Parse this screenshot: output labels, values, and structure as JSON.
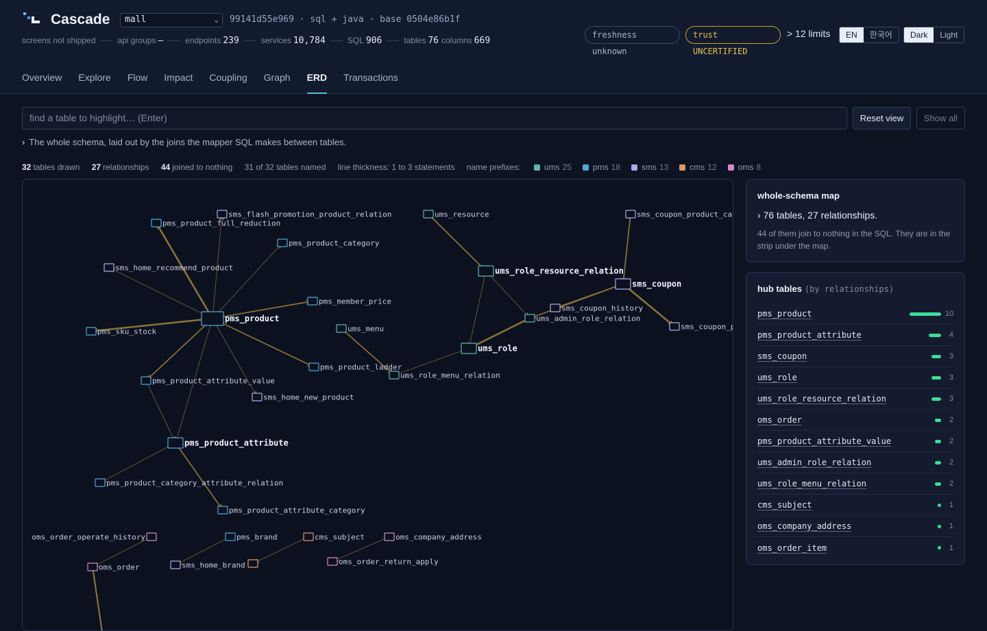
{
  "app": {
    "name": "Cascade",
    "repo": "mall",
    "meta": "99141d55e969 · sql + java · base 0504e86b1f"
  },
  "stats": [
    {
      "label": "screens not shipped",
      "value": ""
    },
    {
      "label": "api groups",
      "value": "—"
    },
    {
      "label": "endpoints",
      "value": "239"
    },
    {
      "label": "services",
      "value": "10,784"
    },
    {
      "label": "SQL",
      "value": "906"
    },
    {
      "label": "tables",
      "value": "76"
    },
    {
      "label": "columns",
      "value": "669"
    }
  ],
  "badges": {
    "freshness": "freshness unknown",
    "trust": "trust UNCERTIFIED",
    "limits": "> 12 limits"
  },
  "language": {
    "options": [
      "EN",
      "한국어"
    ],
    "active": "EN"
  },
  "theme": {
    "options": [
      "Dark",
      "Light"
    ],
    "active": "Dark"
  },
  "tabs": [
    "Overview",
    "Explore",
    "Flow",
    "Impact",
    "Coupling",
    "Graph",
    "ERD",
    "Transactions"
  ],
  "active_tab": "ERD",
  "search": {
    "placeholder": "find a table to highlight… (Enter)"
  },
  "buttons": {
    "reset": "Reset view",
    "show_all": "Show all"
  },
  "lede": "The whole schema, laid out by the joins the mapper SQL makes between tables.",
  "summary": {
    "tables_drawn": "32",
    "tables_drawn_label": "tables drawn",
    "relationships": "27",
    "relationships_label": "relationships",
    "isolated": "44",
    "isolated_label": "joined to nothing",
    "named": "31 of 32 tables named",
    "thickness": "line thickness: 1 to 3 statements",
    "prefixes_label": "name prefixes:"
  },
  "prefixes": [
    {
      "name": "ums",
      "count": "25",
      "color": "#5fb8a8"
    },
    {
      "name": "pms",
      "count": "18",
      "color": "#4fa9d4"
    },
    {
      "name": "sms",
      "count": "13",
      "color": "#a8aee8"
    },
    {
      "name": "cms",
      "count": "12",
      "color": "#d99a6c"
    },
    {
      "name": "oms",
      "count": "8",
      "color": "#d18ac9"
    }
  ],
  "erd": {
    "tables": [
      {
        "id": "sms_flash_promotion_product_relation",
        "label": "sms_flash_promotion_product_relation",
        "prefix": "sms"
      },
      {
        "id": "pms_product_full_reduction",
        "label": "pms_product_full_reduction",
        "prefix": "pms"
      },
      {
        "id": "pms_product_category",
        "label": "pms_product_category",
        "prefix": "pms"
      },
      {
        "id": "sms_home_recommend_product",
        "label": "sms_home_recommend_product",
        "prefix": "sms"
      },
      {
        "id": "pms_member_price",
        "label": "pms_member_price",
        "prefix": "pms"
      },
      {
        "id": "pms_product",
        "label": "pms_product",
        "prefix": "pms",
        "hub": true
      },
      {
        "id": "pms_sku_stock",
        "label": "pms_sku_stock",
        "prefix": "pms"
      },
      {
        "id": "ums_menu",
        "label": "ums_menu",
        "prefix": "ums"
      },
      {
        "id": "pms_product_ladder",
        "label": "pms_product_ladder",
        "prefix": "pms"
      },
      {
        "id": "pms_product_attribute_value",
        "label": "pms_product_attribute_value",
        "prefix": "pms"
      },
      {
        "id": "sms_home_new_product",
        "label": "sms_home_new_product",
        "prefix": "sms"
      },
      {
        "id": "pms_product_attribute",
        "label": "pms_product_attribute",
        "prefix": "pms",
        "hub": true
      },
      {
        "id": "pms_product_category_attribute_relation",
        "label": "pms_product_category_attribute_relation",
        "prefix": "pms"
      },
      {
        "id": "pms_product_attribute_category",
        "label": "pms_product_attribute_category",
        "prefix": "pms"
      },
      {
        "id": "ums_resource",
        "label": "ums_resource",
        "prefix": "ums"
      },
      {
        "id": "ums_role_resource_relation",
        "label": "ums_role_resource_relation",
        "prefix": "ums",
        "hub": true
      },
      {
        "id": "ums_admin_role_relation",
        "label": "ums_admin_role_relation",
        "prefix": "ums"
      },
      {
        "id": "ums_role",
        "label": "ums_role",
        "prefix": "ums",
        "hub": true
      },
      {
        "id": "ums_role_menu_relation",
        "label": "ums_role_menu_relation",
        "prefix": "ums"
      },
      {
        "id": "sms_coupon_product_category_relation",
        "label": "sms_coupon_product_cate",
        "prefix": "sms"
      },
      {
        "id": "sms_coupon",
        "label": "sms_coupon",
        "prefix": "sms",
        "hub": true
      },
      {
        "id": "sms_coupon_history",
        "label": "sms_coupon_history",
        "prefix": "sms"
      },
      {
        "id": "sms_coupon_product_relation",
        "label": "sms_coupon_pr",
        "prefix": "sms"
      },
      {
        "id": "oms_order_operate_history",
        "label": "oms_order_operate_history",
        "prefix": "oms"
      },
      {
        "id": "oms_order",
        "label": "oms_order",
        "prefix": "oms"
      },
      {
        "id": "pms_brand",
        "label": "pms_brand",
        "prefix": "pms"
      },
      {
        "id": "sms_home_brand",
        "label": "sms_home_brand",
        "prefix": "sms"
      },
      {
        "id": "cms_subject",
        "label": "cms_subject",
        "prefix": "cms"
      },
      {
        "id": "cms_subject_product_relation",
        "label": "",
        "prefix": "cms"
      },
      {
        "id": "oms_company_address",
        "label": "oms_company_address",
        "prefix": "oms"
      },
      {
        "id": "oms_order_return_apply",
        "label": "oms_order_return_apply",
        "prefix": "oms"
      }
    ],
    "relationships": [
      [
        "pms_product",
        "pms_product_full_reduction",
        3
      ],
      [
        "pms_product",
        "sms_flash_promotion_product_relation",
        1
      ],
      [
        "pms_product",
        "pms_product_category",
        1
      ],
      [
        "pms_product",
        "sms_home_recommend_product",
        1
      ],
      [
        "pms_product",
        "pms_member_price",
        2
      ],
      [
        "pms_product",
        "pms_sku_stock",
        3
      ],
      [
        "pms_product",
        "pms_product_ladder",
        2
      ],
      [
        "pms_product",
        "pms_product_attribute_value",
        2
      ],
      [
        "pms_product",
        "sms_home_new_product",
        1
      ],
      [
        "pms_product",
        "pms_product_attribute",
        1
      ],
      [
        "pms_product_attribute_value",
        "pms_product_attribute",
        1
      ],
      [
        "pms_product_attribute",
        "pms_product_category_attribute_relation",
        1
      ],
      [
        "pms_product_attribute",
        "pms_product_attribute_category",
        2
      ],
      [
        "ums_resource",
        "ums_role_resource_relation",
        2
      ],
      [
        "ums_role_resource_relation",
        "ums_role",
        1
      ],
      [
        "ums_role_resource_relation",
        "ums_admin_role_relation",
        1
      ],
      [
        "ums_admin_role_relation",
        "ums_role",
        3
      ],
      [
        "ums_menu",
        "ums_role_menu_relation",
        2
      ],
      [
        "ums_role_menu_relation",
        "ums_role",
        1
      ],
      [
        "sms_coupon_product_category_relation",
        "sms_coupon",
        2
      ],
      [
        "sms_coupon",
        "sms_coupon_history",
        2
      ],
      [
        "sms_coupon",
        "sms_coupon_product_relation",
        3
      ],
      [
        "sms_coupon",
        "ums_admin_role_relation",
        2
      ],
      [
        "oms_order_operate_history",
        "oms_order",
        1
      ],
      [
        "pms_brand",
        "sms_home_brand",
        1
      ],
      [
        "cms_subject",
        "cms_subject_product_relation",
        1
      ],
      [
        "oms_company_address",
        "oms_order_return_apply",
        1
      ]
    ]
  },
  "schema_map": {
    "title": "whole-schema map",
    "headline": "76 tables, 27 relationships.",
    "note": "44 of them join to nothing in the SQL. They are in the strip under the map."
  },
  "hubs": {
    "title": "hub tables",
    "subtitle": "(by relationships)",
    "items": [
      {
        "name": "pms_product",
        "count": 10
      },
      {
        "name": "pms_product_attribute",
        "count": 4
      },
      {
        "name": "sms_coupon",
        "count": 3
      },
      {
        "name": "ums_role",
        "count": 3
      },
      {
        "name": "ums_role_resource_relation",
        "count": 3
      },
      {
        "name": "oms_order",
        "count": 2
      },
      {
        "name": "pms_product_attribute_value",
        "count": 2
      },
      {
        "name": "ums_admin_role_relation",
        "count": 2
      },
      {
        "name": "ums_role_menu_relation",
        "count": 2
      },
      {
        "name": "cms_subject",
        "count": 1
      },
      {
        "name": "oms_company_address",
        "count": 1
      },
      {
        "name": "oms_order_item",
        "count": 1
      }
    ]
  }
}
